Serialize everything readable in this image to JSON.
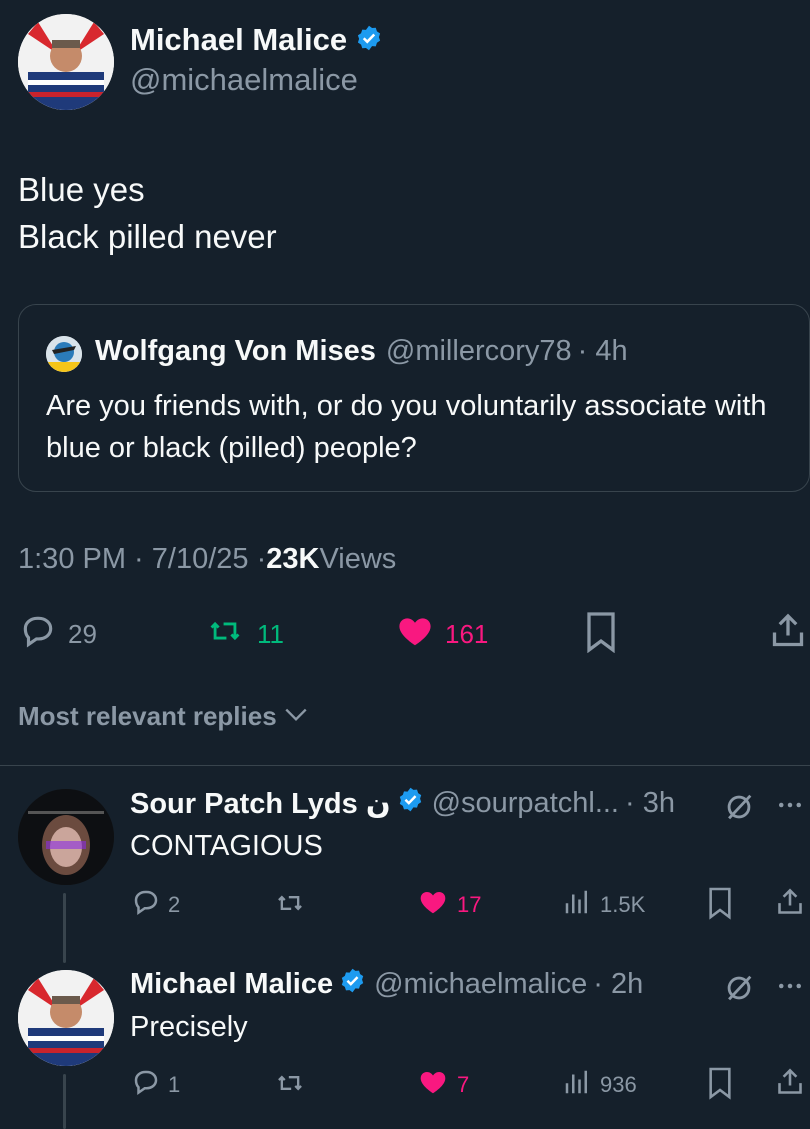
{
  "main_tweet": {
    "author_name": "Michael Malice",
    "author_handle": "@michaelmalice",
    "text_line1": "Blue yes",
    "text_line2": "Black pilled never",
    "timestamp": "1:30 PM · 7/10/25 · ",
    "views_count": "23K",
    "views_label": " Views",
    "replies": "29",
    "retweets": "11",
    "likes": "161"
  },
  "quoted_tweet": {
    "author_name": "Wolfgang Von Mises",
    "author_handle": "@millercory78",
    "time": "· 4h",
    "text": "Are you friends with, or do you voluntarily associate with blue or black (pilled) people?"
  },
  "sort": {
    "label": "Most relevant replies"
  },
  "replies": [
    {
      "author_name": "Sour Patch Lyds ن",
      "author_handle": "@sourpatchl...",
      "time": "· 3h",
      "text": "CONTAGIOUS",
      "replies": "2",
      "likes": "17",
      "views": "1.5K"
    },
    {
      "author_name": "Michael Malice",
      "author_handle": "@michaelmalice",
      "time": "· 2h",
      "text": "Precisely",
      "replies": "1",
      "likes": "7",
      "views": "936"
    }
  ],
  "colors": {
    "background": "#15202b",
    "verified": "#1d9bf0",
    "retweet": "#00ba7c",
    "like": "#f91880",
    "muted": "#8b98a5"
  }
}
